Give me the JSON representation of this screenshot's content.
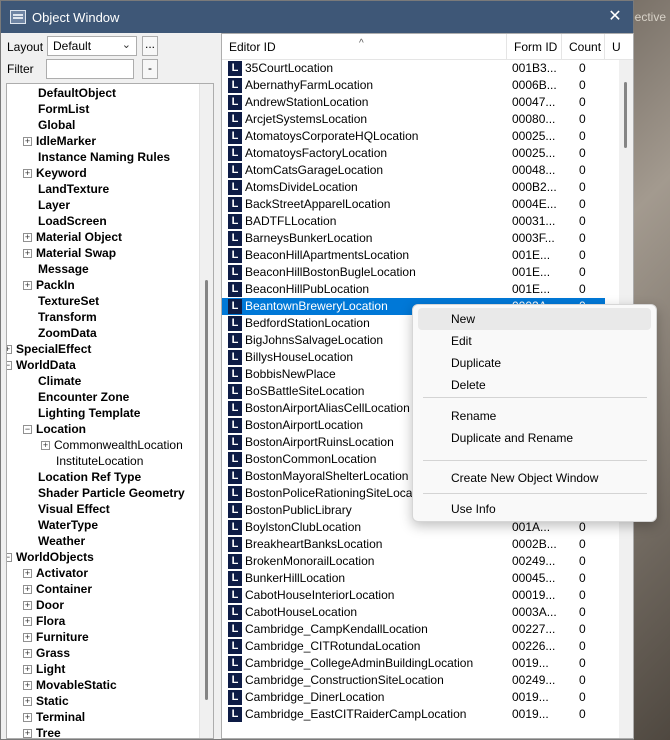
{
  "background": {
    "partial_text": "pective"
  },
  "window": {
    "title": "Object Window",
    "close_glyph": "✕"
  },
  "left": {
    "layout_label": "Layout",
    "layout_value": "Default",
    "dots_label": "...",
    "filter_label": "Filter",
    "filter_value": "",
    "minus_label": "-",
    "tree": [
      {
        "label": "DefaultObject",
        "indent": 30,
        "exp": ""
      },
      {
        "label": "FormList",
        "indent": 30,
        "exp": ""
      },
      {
        "label": "Global",
        "indent": 30,
        "exp": ""
      },
      {
        "label": "IdleMarker",
        "indent": 30,
        "exp": "+"
      },
      {
        "label": "Instance Naming Rules",
        "indent": 30,
        "exp": ""
      },
      {
        "label": "Keyword",
        "indent": 30,
        "exp": "+"
      },
      {
        "label": "LandTexture",
        "indent": 30,
        "exp": ""
      },
      {
        "label": "Layer",
        "indent": 30,
        "exp": ""
      },
      {
        "label": "LoadScreen",
        "indent": 30,
        "exp": ""
      },
      {
        "label": "Material Object",
        "indent": 30,
        "exp": "+"
      },
      {
        "label": "Material Swap",
        "indent": 30,
        "exp": "+"
      },
      {
        "label": "Message",
        "indent": 30,
        "exp": ""
      },
      {
        "label": "PackIn",
        "indent": 30,
        "exp": "+"
      },
      {
        "label": "TextureSet",
        "indent": 30,
        "exp": ""
      },
      {
        "label": "Transform",
        "indent": 30,
        "exp": ""
      },
      {
        "label": "ZoomData",
        "indent": 30,
        "exp": ""
      },
      {
        "label": "SpecialEffect",
        "indent": 10,
        "exp": "+"
      },
      {
        "label": "WorldData",
        "indent": 10,
        "exp": "−"
      },
      {
        "label": "Climate",
        "indent": 30,
        "exp": ""
      },
      {
        "label": "Encounter Zone",
        "indent": 30,
        "exp": ""
      },
      {
        "label": "Lighting Template",
        "indent": 30,
        "exp": ""
      },
      {
        "label": "Location",
        "indent": 30,
        "exp": "−"
      },
      {
        "label": "CommonwealthLocation",
        "indent": 48,
        "exp": "+",
        "plain": true
      },
      {
        "label": "InstituteLocation",
        "indent": 48,
        "exp": "",
        "plain": true
      },
      {
        "label": "Location Ref Type",
        "indent": 30,
        "exp": ""
      },
      {
        "label": "Shader Particle Geometry",
        "indent": 30,
        "exp": ""
      },
      {
        "label": "Visual Effect",
        "indent": 30,
        "exp": ""
      },
      {
        "label": "WaterType",
        "indent": 30,
        "exp": ""
      },
      {
        "label": "Weather",
        "indent": 30,
        "exp": ""
      },
      {
        "label": "WorldObjects",
        "indent": 10,
        "exp": "−"
      },
      {
        "label": "Activator",
        "indent": 30,
        "exp": "+"
      },
      {
        "label": "Container",
        "indent": 30,
        "exp": "+"
      },
      {
        "label": "Door",
        "indent": 30,
        "exp": "+"
      },
      {
        "label": "Flora",
        "indent": 30,
        "exp": "+"
      },
      {
        "label": "Furniture",
        "indent": 30,
        "exp": "+"
      },
      {
        "label": "Grass",
        "indent": 30,
        "exp": "+"
      },
      {
        "label": "Light",
        "indent": 30,
        "exp": "+"
      },
      {
        "label": "MovableStatic",
        "indent": 30,
        "exp": "+"
      },
      {
        "label": "Static",
        "indent": 30,
        "exp": "+"
      },
      {
        "label": "Terminal",
        "indent": 30,
        "exp": "+"
      },
      {
        "label": "Tree",
        "indent": 30,
        "exp": "+"
      }
    ]
  },
  "list": {
    "columns": {
      "editor_id": "Editor ID",
      "form_id": "Form ID",
      "count": "Count",
      "users": "U"
    },
    "icon_glyph": "L",
    "rows": [
      {
        "id": "35CourtLocation",
        "form": "001B3...",
        "count": "0"
      },
      {
        "id": "AbernathyFarmLocation",
        "form": "0006B...",
        "count": "0"
      },
      {
        "id": "AndrewStationLocation",
        "form": "00047...",
        "count": "0"
      },
      {
        "id": "ArcjetSystemsLocation",
        "form": "00080...",
        "count": "0"
      },
      {
        "id": "AtomatoysCorporateHQLocation",
        "form": "00025...",
        "count": "0"
      },
      {
        "id": "AtomatoysFactoryLocation",
        "form": "00025...",
        "count": "0"
      },
      {
        "id": "AtomCatsGarageLocation",
        "form": "00048...",
        "count": "0"
      },
      {
        "id": "AtomsDivideLocation",
        "form": "000B2...",
        "count": "0"
      },
      {
        "id": "BackStreetApparelLocation",
        "form": "0004E...",
        "count": "0"
      },
      {
        "id": "BADTFLLocation",
        "form": "00031...",
        "count": "0"
      },
      {
        "id": "BarneysBunkerLocation",
        "form": "0003F...",
        "count": "0"
      },
      {
        "id": "BeaconHillApartmentsLocation",
        "form": "001E...",
        "count": "0"
      },
      {
        "id": "BeaconHillBostonBugleLocation",
        "form": "001E...",
        "count": "0"
      },
      {
        "id": "BeaconHillPubLocation",
        "form": "001E...",
        "count": "0"
      },
      {
        "id": "BeantownBreweryLocation",
        "form": "0002A...",
        "count": "0",
        "selected": true
      },
      {
        "id": "BedfordStationLocation",
        "form": "",
        "count": ""
      },
      {
        "id": "BigJohnsSalvageLocation",
        "form": "",
        "count": ""
      },
      {
        "id": "BillysHouseLocation",
        "form": "",
        "count": ""
      },
      {
        "id": "BobbisNewPlace",
        "form": "",
        "count": ""
      },
      {
        "id": "BoSBattleSiteLocation",
        "form": "",
        "count": ""
      },
      {
        "id": "BostonAirportAliasCellLocation",
        "form": "",
        "count": ""
      },
      {
        "id": "BostonAirportLocation",
        "form": "",
        "count": ""
      },
      {
        "id": "BostonAirportRuinsLocation",
        "form": "",
        "count": ""
      },
      {
        "id": "BostonCommonLocation",
        "form": "",
        "count": ""
      },
      {
        "id": "BostonMayoralShelterLocation",
        "form": "",
        "count": ""
      },
      {
        "id": "BostonPoliceRationingSiteLocation",
        "form": "",
        "count": ""
      },
      {
        "id": "BostonPublicLibrary",
        "form": "",
        "count": ""
      },
      {
        "id": "BoylstonClubLocation",
        "form": "001A...",
        "count": "0"
      },
      {
        "id": "BreakheartBanksLocation",
        "form": "0002B...",
        "count": "0"
      },
      {
        "id": "BrokenMonorailLocation",
        "form": "00249...",
        "count": "0"
      },
      {
        "id": "BunkerHillLocation",
        "form": "00045...",
        "count": "0"
      },
      {
        "id": "CabotHouseInteriorLocation",
        "form": "00019...",
        "count": "0"
      },
      {
        "id": "CabotHouseLocation",
        "form": "0003A...",
        "count": "0"
      },
      {
        "id": "Cambridge_CampKendallLocation",
        "form": "00227...",
        "count": "0"
      },
      {
        "id": "Cambridge_CITRotundaLocation",
        "form": "00226...",
        "count": "0"
      },
      {
        "id": "Cambridge_CollegeAdminBuildingLocation",
        "form": "0019...",
        "count": "0"
      },
      {
        "id": "Cambridge_ConstructionSiteLocation",
        "form": "00249...",
        "count": "0"
      },
      {
        "id": "Cambridge_DinerLocation",
        "form": "0019...",
        "count": "0"
      },
      {
        "id": "Cambridge_EastCITRaiderCampLocation",
        "form": "0019...",
        "count": "0"
      }
    ]
  },
  "context_menu": {
    "items": [
      {
        "label": "New",
        "name": "menu-new"
      },
      {
        "label": "Edit",
        "name": "menu-edit"
      },
      {
        "label": "Duplicate",
        "name": "menu-duplicate"
      },
      {
        "label": "Delete",
        "name": "menu-delete"
      },
      {
        "label": "Rename",
        "name": "menu-rename"
      },
      {
        "label": "Duplicate and Rename",
        "name": "menu-duplicate-and-rename"
      },
      {
        "label": "Create New Object Window",
        "name": "menu-create-new-object-window"
      },
      {
        "label": "Use Info",
        "name": "menu-use-info"
      }
    ]
  }
}
